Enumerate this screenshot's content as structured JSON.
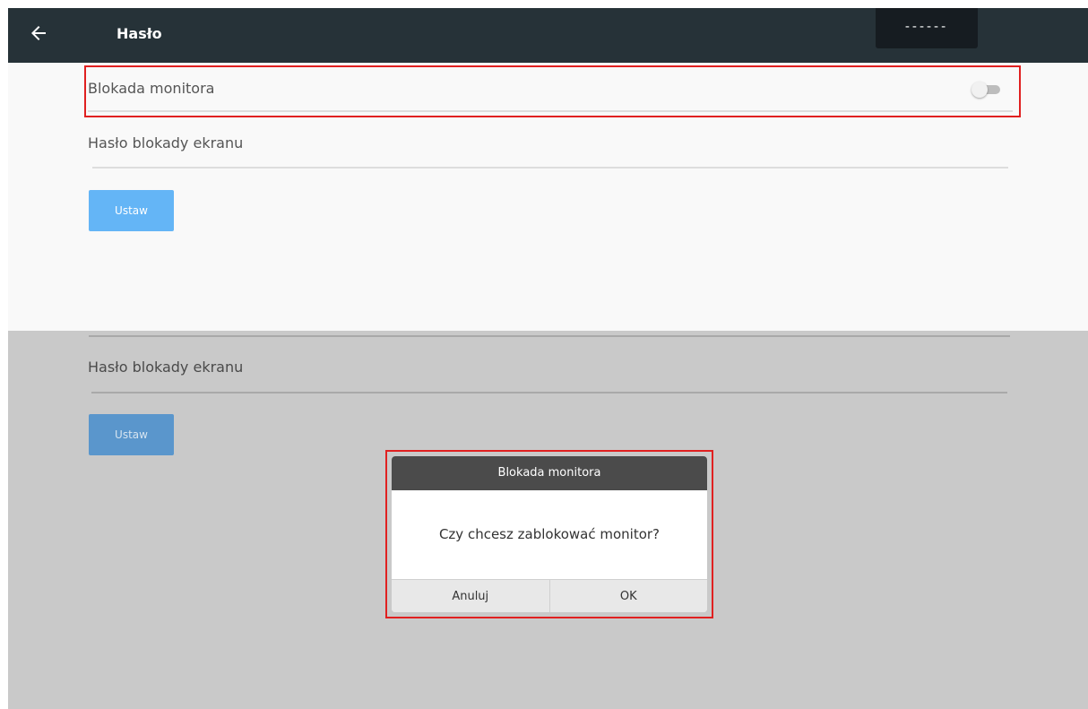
{
  "top_screen": {
    "appbar": {
      "back_icon": "arrow-left-icon",
      "title": "Hasło",
      "password_display": "------"
    },
    "monitor_lock": {
      "label": "Blokada monitora",
      "enabled": false
    },
    "screen_lock_password": {
      "label": "Hasło blokady ekranu"
    },
    "set_button": {
      "label": "Ustaw"
    }
  },
  "bottom_screen": {
    "screen_lock_password": {
      "label": "Hasło blokady ekranu"
    },
    "set_button": {
      "label": "Ustaw"
    },
    "dialog": {
      "title": "Blokada monitora",
      "message": "Czy chcesz zablokować monitor?",
      "cancel_label": "Anuluj",
      "ok_label": "OK"
    }
  },
  "colors": {
    "appbar": "#263238",
    "button": "#64b5f6",
    "highlight": "#e02020",
    "overlay": "#c9c9c9"
  }
}
